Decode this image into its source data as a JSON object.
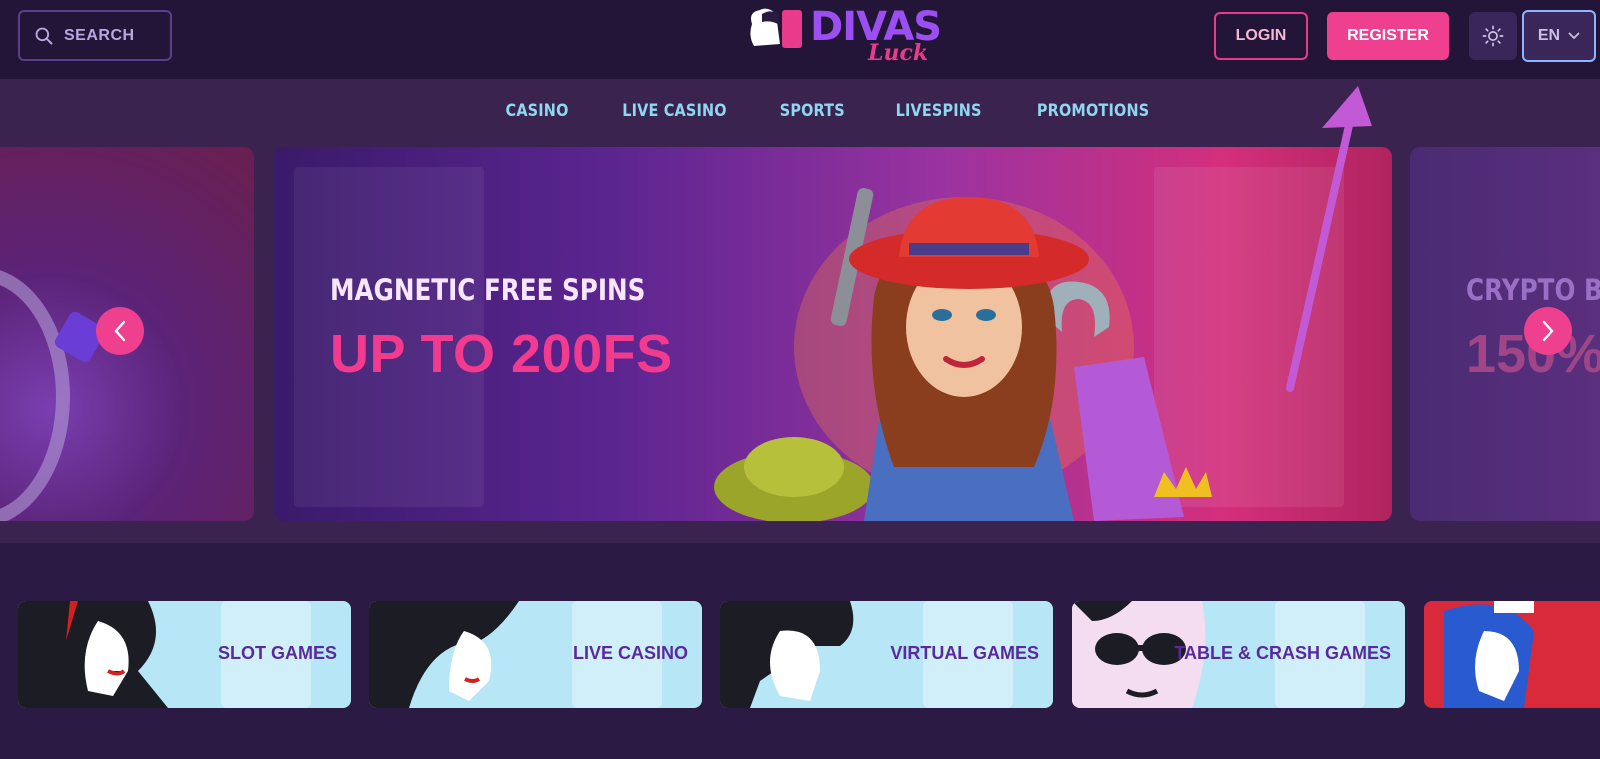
{
  "header": {
    "search_label": "SEARCH",
    "logo_main": "DIVAS",
    "logo_sub": "Luck",
    "login_label": "LOGIN",
    "register_label": "REGISTER",
    "language": "EN"
  },
  "nav": {
    "items": [
      {
        "label": "CASINO"
      },
      {
        "label": "LIVE CASINO"
      },
      {
        "label": "SPORTS"
      },
      {
        "label": "LIVESPINS"
      },
      {
        "label": "PROMOTIONS"
      }
    ]
  },
  "carousel": {
    "main": {
      "kicker": "MAGNETIC FREE SPINS",
      "title": "UP TO 200FS"
    },
    "right": {
      "kicker": "CRYPTO BONUS",
      "title": "150%"
    }
  },
  "categories": [
    {
      "label": "SLOT GAMES"
    },
    {
      "label": "LIVE CASINO"
    },
    {
      "label": "VIRTUAL GAMES"
    },
    {
      "label": "TABLE & CRASH GAMES"
    }
  ],
  "colors": {
    "accent_pink": "#ef3f8f",
    "nav_text": "#8fd6ef",
    "tile_bg": "#b7e7f6",
    "tile_text": "#5a2a9c",
    "annotation_arrow": "#c25ad6"
  },
  "icons": [
    "search-icon",
    "sun-icon",
    "chevron-down-icon",
    "chevron-left-icon",
    "chevron-right-icon"
  ]
}
